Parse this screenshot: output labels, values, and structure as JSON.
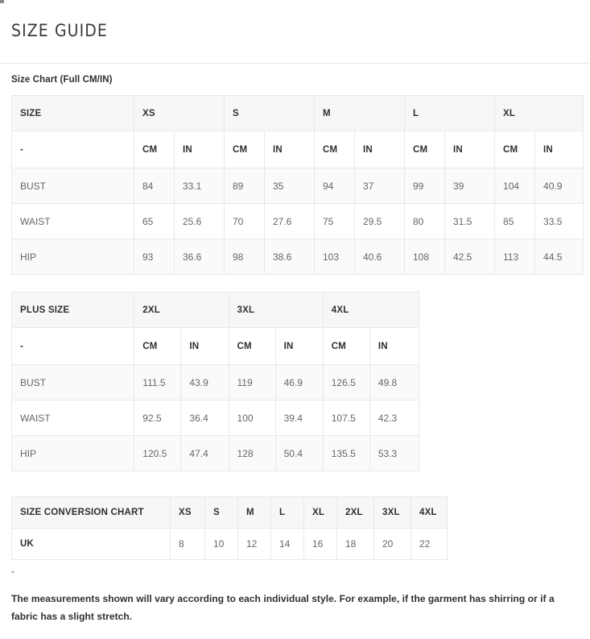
{
  "header": {
    "title": "SIZE GUIDE"
  },
  "section": {
    "label": "Size Chart (Full CM/IN)"
  },
  "size_chart": {
    "corner_label": "SIZE",
    "dash_label": "-",
    "sizes": [
      "XS",
      "S",
      "M",
      "L",
      "XL"
    ],
    "units": [
      "CM",
      "IN"
    ],
    "rows": [
      {
        "label": "BUST",
        "values": [
          "84",
          "33.1",
          "89",
          "35",
          "94",
          "37",
          "99",
          "39",
          "104",
          "40.9"
        ]
      },
      {
        "label": "WAIST",
        "values": [
          "65",
          "25.6",
          "70",
          "27.6",
          "75",
          "29.5",
          "80",
          "31.5",
          "85",
          "33.5"
        ]
      },
      {
        "label": "HIP",
        "values": [
          "93",
          "36.6",
          "98",
          "38.6",
          "103",
          "40.6",
          "108",
          "42.5",
          "113",
          "44.5"
        ]
      }
    ]
  },
  "plus_size_chart": {
    "corner_label": "PLUS SIZE",
    "dash_label": "-",
    "sizes": [
      "2XL",
      "3XL",
      "4XL"
    ],
    "units": [
      "CM",
      "IN"
    ],
    "rows": [
      {
        "label": "BUST",
        "values": [
          "111.5",
          "43.9",
          "119",
          "46.9",
          "126.5",
          "49.8"
        ]
      },
      {
        "label": "WAIST",
        "values": [
          "92.5",
          "36.4",
          "100",
          "39.4",
          "107.5",
          "42.3"
        ]
      },
      {
        "label": "HIP",
        "values": [
          "120.5",
          "47.4",
          "128",
          "50.4",
          "135.5",
          "53.3"
        ]
      }
    ]
  },
  "conversion_chart": {
    "corner_label": "SIZE CONVERSION CHART",
    "columns": [
      "XS",
      "S",
      "M",
      "L",
      "XL",
      "2XL",
      "3XL",
      "4XL"
    ],
    "rows": [
      {
        "label": "UK",
        "values": [
          "8",
          "10",
          "12",
          "14",
          "16",
          "18",
          "20",
          "22"
        ]
      }
    ]
  },
  "footer": {
    "dash": "-",
    "note": "The measurements shown will vary according to each individual style. For example, if the garment has shirring or if a fabric has a slight stretch."
  }
}
